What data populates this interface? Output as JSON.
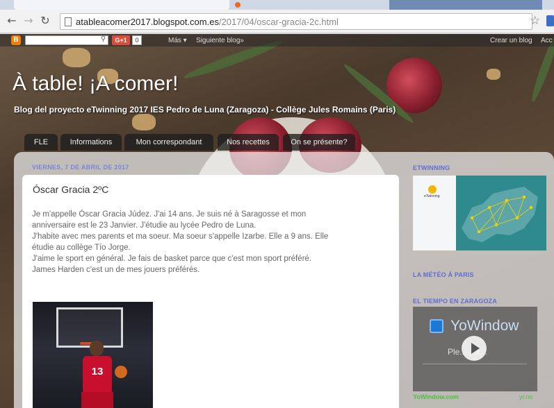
{
  "browser": {
    "url_domain": "atableacomer2017.blogspot.com.es",
    "url_path": "/2017/04/oscar-gracia-2c.html",
    "back_icon": "arrow-left",
    "forward_icon": "arrow-right",
    "reload_icon": "reload",
    "bookmark_icon": "star"
  },
  "navbar": {
    "gplus_label": "G+1",
    "gplus_count": "0",
    "more_label": "Más ▾",
    "next_blog_label": "Siguiente blog»",
    "create_blog_label": "Crear un blog",
    "access_label": "Acc"
  },
  "header": {
    "title": "À table! ¡A comer!",
    "description": "Blog del proyecto eTwinning 2017 IES Pedro de Luna (Zaragoza) - Collège Jules Romains (Paris)"
  },
  "tabs": [
    {
      "label": "FLE"
    },
    {
      "label": "Informations"
    },
    {
      "label": "Mon correspondant"
    },
    {
      "label": "Nos recettes"
    },
    {
      "label": "On se présente?"
    }
  ],
  "post": {
    "date": "VIERNES, 7 DE ABRIL DE 2017",
    "title": "Óscar Gracia 2ºC",
    "lines": [
      "Je m'appelle Óscar Gracia Júdez. J'ai 14 ans. Je suis né à  Saragosse et mon",
      "anniversaire est le 23 Janvier. J'étudie au lycée Pedro de Luna.",
      "J'habite avec mes parents et ma soeur. Ma soeur s'appelle Izarbe. Elle a 9 ans. Elle",
      "étudie au collège Tío Jorge.",
      "J'aime le sport en général. Je fais de basket parce que c'est mon sport préféré.",
      "James Harden c'est un de mes jouers préférés."
    ],
    "image_jersey_number": "13"
  },
  "sidebar": {
    "etwinning_heading": "ETWINNING",
    "etwinning_logo_text": "eTwinning",
    "meteo_paris_heading": "LA MÉTÉO À PARIS",
    "tiempo_zaragoza_heading": "EL TIEMPO EN ZARAGOZA",
    "weather_brand": "YoWindow",
    "weather_status": "Ple...  ...it...",
    "weather_footer_left": "YoWindow.com",
    "weather_footer_right": "yr.no"
  },
  "colors": {
    "accent_date": "#7a85d8",
    "sidebar_heading": "#5f6bd6",
    "yowindow_link": "#4fbf3f"
  }
}
